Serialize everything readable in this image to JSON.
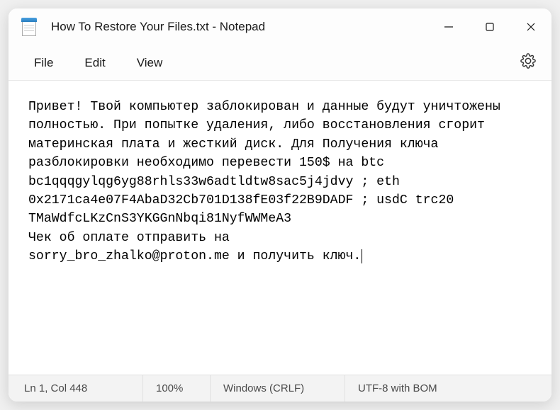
{
  "titlebar": {
    "title": "How To Restore Your Files.txt - Notepad"
  },
  "menu": {
    "file": "File",
    "edit": "Edit",
    "view": "View"
  },
  "content": {
    "text": "Привет! Твой компьютер заблокирован и данные будут уничтожены полностью. При попытке удаления, либо восстановления сгорит материнская плата и жесткий диск. Для Получения ключа разблокировки необходимо перевести 150$ на btc bc1qqqgylqg6yg88rhls33w6adtldtw8sac5j4jdvy ; eth 0x2171ca4e07F4AbaD32Cb701D138fE03f22B9DADF ; usdC trc20 TMaWdfcLKzCnS3YKGGnNbqi81NyfWWMeA3\nЧек об оплате отправить на\nsorry_bro_zhalko@proton.me и получить ключ."
  },
  "statusbar": {
    "position": "Ln 1, Col 448",
    "zoom": "100%",
    "line_ending": "Windows (CRLF)",
    "encoding": "UTF-8 with BOM"
  }
}
